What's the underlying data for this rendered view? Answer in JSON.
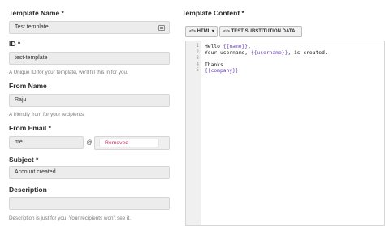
{
  "form": {
    "template_name": {
      "label": "Template Name *",
      "value": "Test template",
      "icon": "template-icon"
    },
    "id": {
      "label": "ID *",
      "value": "test-template",
      "hint": "A Unique ID for your template, we'll fill this in for you."
    },
    "from_name": {
      "label": "From Name",
      "value": "Raju",
      "hint": "A friendly from for your recipients."
    },
    "from_email": {
      "label": "From Email *",
      "local_part": "me",
      "at": "@",
      "domain_placeholder": "Removed"
    },
    "subject": {
      "label": "Subject *",
      "value": "Account created"
    },
    "description": {
      "label": "Description",
      "value": "",
      "hint": "Description is just for you. Your recipients won't see it."
    }
  },
  "template_content": {
    "label": "Template Content *",
    "format_button": "HTML ▾",
    "test_button": "TEST SUBSTITUTION DATA",
    "code_lines": [
      {
        "n": "1",
        "parts": [
          {
            "t": "Hello "
          },
          {
            "t": "{{name}}",
            "v": true
          },
          {
            "t": ","
          }
        ]
      },
      {
        "n": "2",
        "parts": [
          {
            "t": "Your username, "
          },
          {
            "t": "{{username}}",
            "v": true
          },
          {
            "t": ", is created."
          }
        ]
      },
      {
        "n": "3",
        "parts": []
      },
      {
        "n": "4",
        "parts": [
          {
            "t": "Thanks"
          }
        ]
      },
      {
        "n": "5",
        "parts": [
          {
            "t": "{{company}}",
            "v": true
          }
        ]
      }
    ]
  },
  "colors": {
    "variable": "#6a3fb8",
    "removed_text": "#c0306a"
  }
}
